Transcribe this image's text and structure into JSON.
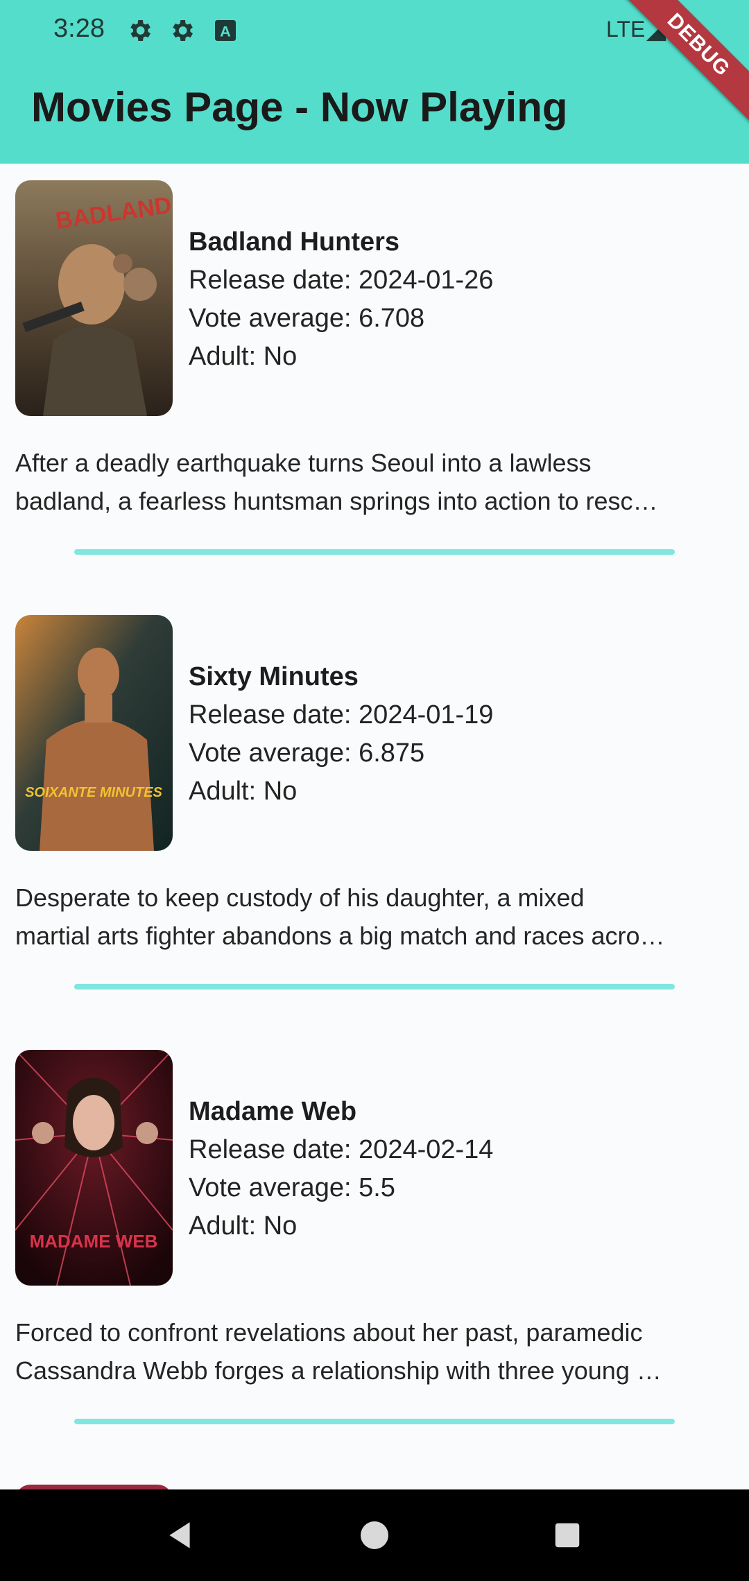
{
  "status_bar": {
    "time": "3:28",
    "network": "LTE",
    "icons": [
      "gear-icon",
      "gear-icon",
      "a-box-icon",
      "signal-icon",
      "battery-icon"
    ]
  },
  "app_bar": {
    "title": "Movies Page - Now Playing",
    "color": "#55ddcc"
  },
  "debug_banner": "DEBUG",
  "movies": [
    {
      "title": "Badland Hunters",
      "poster_text": "BADLAND HUNTERS",
      "release": "Release date: 2024-01-26",
      "vote": "Vote average: 6.708",
      "adult": "Adult: No",
      "overview_lines": [
        "After a deadly earthquake turns Seoul into a lawless",
        "badland, a fearless huntsman springs into action to resc…"
      ]
    },
    {
      "title": "Sixty Minutes",
      "poster_text": "SOIXANTE MINUTES",
      "release": "Release date: 2024-01-19",
      "vote": "Vote average: 6.875",
      "adult": "Adult: No",
      "overview_lines": [
        "Desperate to keep custody of his daughter, a mixed",
        "martial arts fighter abandons a big match and races acro…"
      ]
    },
    {
      "title": "Madame Web",
      "poster_text": "MADAME WEB",
      "release": "Release date: 2024-02-14",
      "vote": "Vote average: 5.5",
      "adult": "Adult: No",
      "overview_lines": [
        "Forced to confront revelations about her past, paramedic",
        "Cassandra Webb forges a relationship with three young …"
      ]
    }
  ],
  "nav_bar": {
    "buttons": [
      "back-icon",
      "home-icon",
      "recents-icon"
    ]
  }
}
